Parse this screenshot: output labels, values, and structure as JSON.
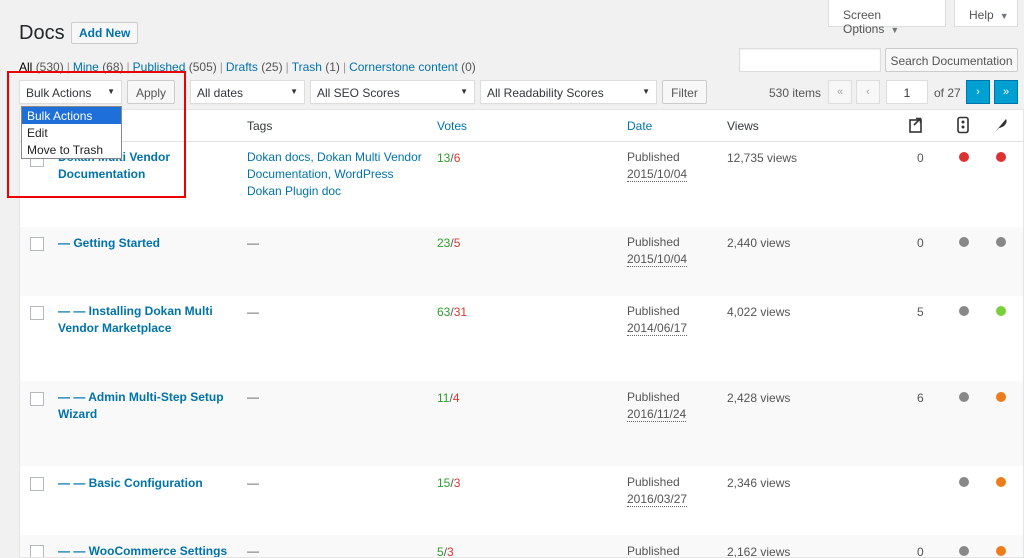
{
  "header": {
    "screen_options": "Screen Options",
    "help": "Help",
    "title": "Docs",
    "add_new": "Add New"
  },
  "filters": {
    "all": "All",
    "all_count": "(530)",
    "mine": "Mine",
    "mine_count": "(68)",
    "published": "Published",
    "published_count": "(505)",
    "drafts": "Drafts",
    "drafts_count": "(25)",
    "trash": "Trash",
    "trash_count": "(1)",
    "cornerstone": "Cornerstone content",
    "cornerstone_count": "(0)"
  },
  "search": {
    "button": "Search Documentation",
    "value": ""
  },
  "toolbar": {
    "bulk_actions": "Bulk Actions",
    "apply": "Apply",
    "dates": "All dates",
    "seo": "All SEO Scores",
    "readability": "All Readability Scores",
    "filter": "Filter"
  },
  "bulk_dropdown": {
    "options": [
      "Bulk Actions",
      "Edit",
      "Move to Trash"
    ],
    "selected": "Bulk Actions"
  },
  "pagination": {
    "items": "530 items",
    "first": "«",
    "prev": "‹",
    "current_page": "1",
    "of": "of 27",
    "next": "›",
    "last": "»"
  },
  "columns": {
    "tags": "Tags",
    "votes": "Votes",
    "date": "Date",
    "views": "Views"
  },
  "colors": {
    "red": "#dc3232",
    "gray": "#888888",
    "green": "#7ad03a",
    "orange": "#ee7c1b"
  },
  "rows": [
    {
      "title": "Dokan Multi Vendor Documentation",
      "tags": "Dokan docs, Dokan Multi Vendor Documentation, WordPress Dokan Plugin doc",
      "votes_up": "13",
      "votes_down": "6",
      "status": "Published",
      "date": "2015/10/04",
      "views": "12,735 views",
      "links": "0",
      "seo": "red",
      "readability": "red"
    },
    {
      "title": "— Getting Started",
      "tags": "—",
      "votes_up": "23",
      "votes_down": "5",
      "status": "Published",
      "date": "2015/10/04",
      "views": "2,440 views",
      "links": "0",
      "seo": "gray",
      "readability": "gray"
    },
    {
      "title": "— — Installing Dokan Multi Vendor Marketplace",
      "tags": "—",
      "votes_up": "63",
      "votes_down": "31",
      "status": "Published",
      "date": "2014/06/17",
      "views": "4,022 views",
      "links": "5",
      "seo": "gray",
      "readability": "green"
    },
    {
      "title": "— — Admin Multi-Step Setup Wizard",
      "tags": "—",
      "votes_up": "11",
      "votes_down": "4",
      "status": "Published",
      "date": "2016/11/24",
      "views": "2,428 views",
      "links": "6",
      "seo": "gray",
      "readability": "orange"
    },
    {
      "title": "— — Basic Configuration",
      "tags": "—",
      "votes_up": "15",
      "votes_down": "3",
      "status": "Published",
      "date": "2016/03/27",
      "views": "2,346 views",
      "links": "",
      "seo": "gray",
      "readability": "orange"
    },
    {
      "title": "— — WooCommerce Settings",
      "tags": "—",
      "votes_up": "5",
      "votes_down": "3",
      "status": "Published",
      "date": "",
      "views": "2,162 views",
      "links": "0",
      "seo": "gray",
      "readability": "orange"
    }
  ]
}
